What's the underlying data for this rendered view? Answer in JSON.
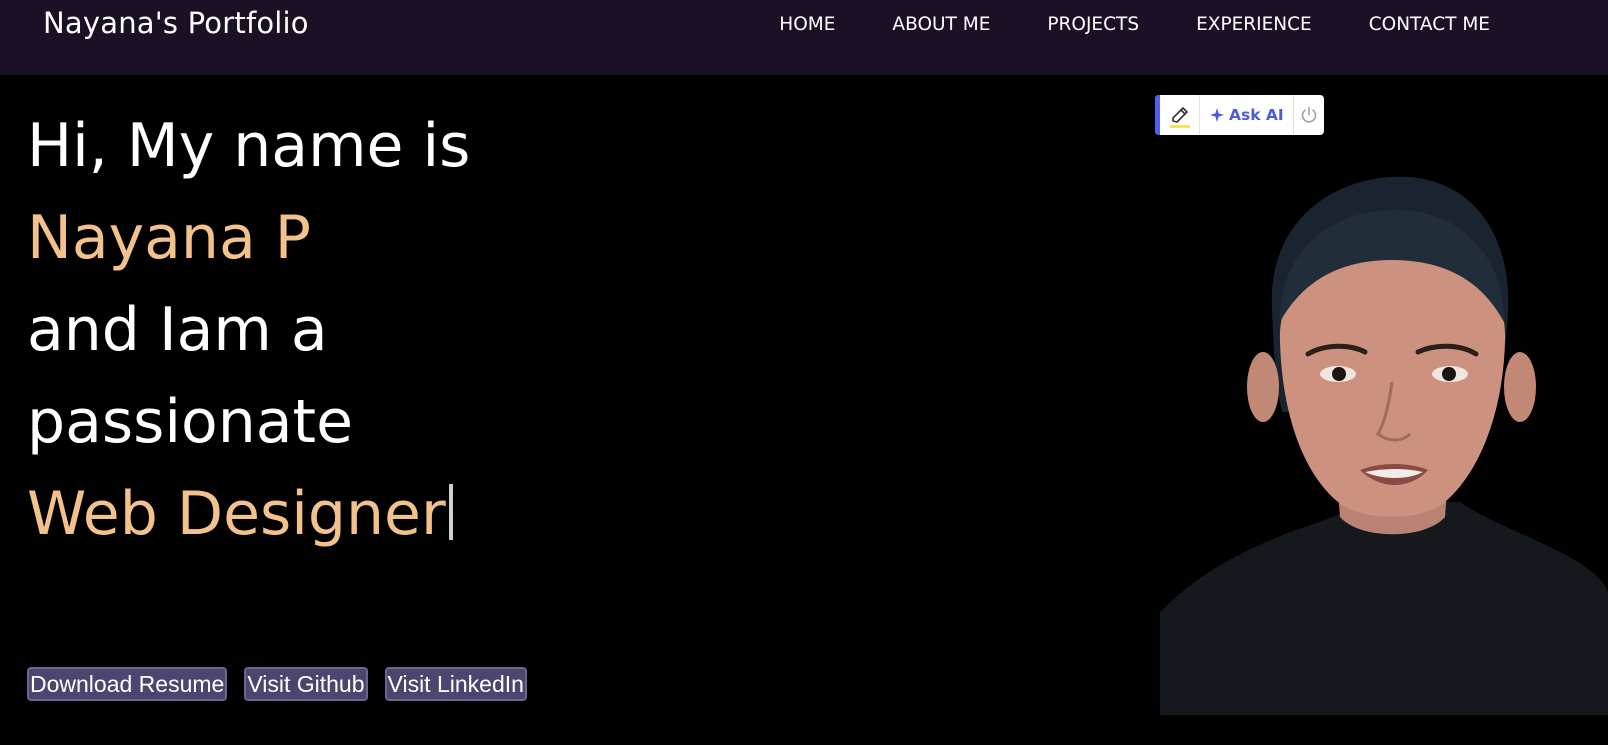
{
  "navbar": {
    "brand": "Nayana's Portfolio",
    "links": [
      "HOME",
      "ABOUT ME",
      "PROJECTS",
      "EXPERIENCE",
      "CONTACT ME"
    ]
  },
  "hero": {
    "line1": "Hi, My name is",
    "name": "Nayana P",
    "line3": "and Iam a",
    "line4": "passionate",
    "role": "Web Designer"
  },
  "buttons": {
    "resume": "Download Resume",
    "github": "Visit Github",
    "linkedin": "Visit LinkedIn"
  },
  "toolbar": {
    "ask_label": "Ask AI",
    "icons": [
      "highlighter-icon",
      "sparkle-icon",
      "power-icon"
    ]
  },
  "colors": {
    "navbar_bg": "#1c1027",
    "accent": "#f2c18c",
    "button_bg": "#4b4570",
    "toolbar_accent": "#4f5ff0"
  }
}
